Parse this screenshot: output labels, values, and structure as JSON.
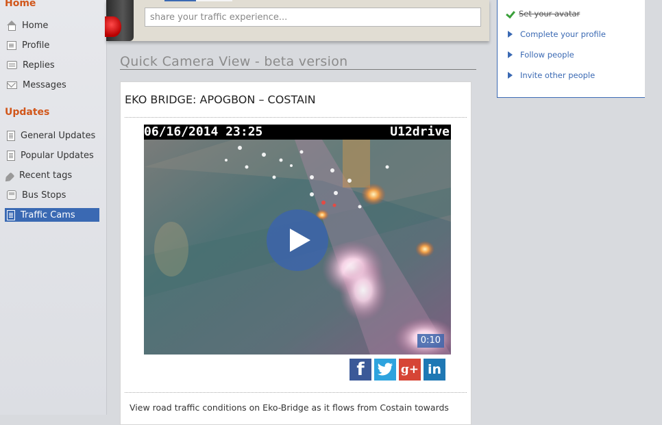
{
  "sidebar": {
    "home_section": "Home",
    "main_items": [
      {
        "label": "Home",
        "icon": "house-icon"
      },
      {
        "label": "Profile",
        "icon": "profile-card-icon"
      },
      {
        "label": "Replies",
        "icon": "replies-icon"
      },
      {
        "label": "Messages",
        "icon": "envelope-icon"
      }
    ],
    "updates_section": "Updates",
    "update_items": [
      {
        "label": "General Updates",
        "icon": "document-icon"
      },
      {
        "label": "Popular Updates",
        "icon": "document-icon"
      },
      {
        "label": "Recent tags",
        "icon": "tag-icon"
      },
      {
        "label": "Bus Stops",
        "icon": "bus-icon"
      },
      {
        "label": "Traffic Cams",
        "icon": "document-icon",
        "active": true
      }
    ]
  },
  "composer": {
    "placeholder": "share your traffic experience..."
  },
  "main": {
    "page_title": "Quick Camera View - beta version",
    "camera": {
      "title": "EKO BRIDGE: APOGBON – COSTAIN",
      "timestamp": "06/16/2014 23:25",
      "brand": "U12drive",
      "duration": "0:10",
      "description": "View road traffic conditions on Eko-Bridge as it flows from Costain towards"
    },
    "share": {
      "facebook": "f",
      "google": "g+",
      "linkedin": "in"
    }
  },
  "checklist": {
    "items": [
      {
        "label": "Set your avatar",
        "done": true
      },
      {
        "label": "Complete your profile",
        "done": false
      },
      {
        "label": "Follow people",
        "done": false
      },
      {
        "label": "Invite other people",
        "done": false
      }
    ]
  },
  "colors": {
    "accent": "#3a69b3",
    "section_heading": "#d1561a",
    "facebook": "#3b5998",
    "twitter": "#2ea3de",
    "google": "#d64536",
    "linkedin": "#1f78b4"
  }
}
